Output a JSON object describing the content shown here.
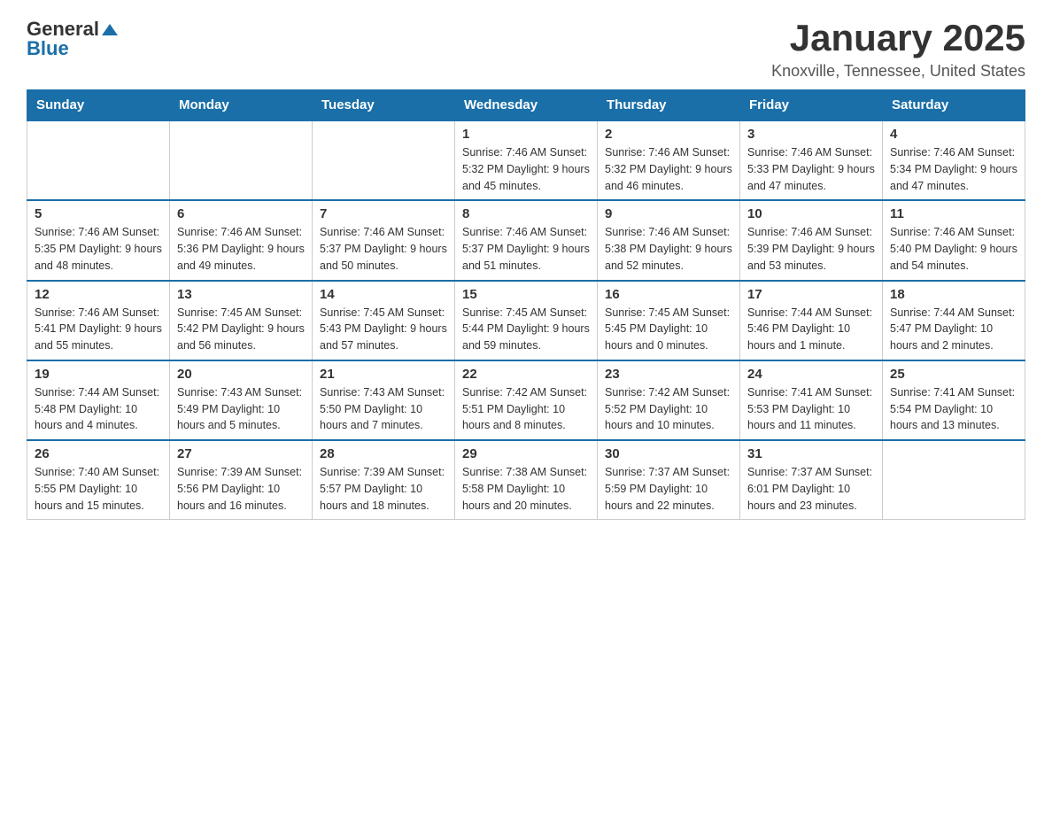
{
  "logo": {
    "general": "General",
    "blue": "Blue"
  },
  "title": "January 2025",
  "subtitle": "Knoxville, Tennessee, United States",
  "weekdays": [
    "Sunday",
    "Monday",
    "Tuesday",
    "Wednesday",
    "Thursday",
    "Friday",
    "Saturday"
  ],
  "weeks": [
    [
      {
        "day": "",
        "info": ""
      },
      {
        "day": "",
        "info": ""
      },
      {
        "day": "",
        "info": ""
      },
      {
        "day": "1",
        "info": "Sunrise: 7:46 AM\nSunset: 5:32 PM\nDaylight: 9 hours and 45 minutes."
      },
      {
        "day": "2",
        "info": "Sunrise: 7:46 AM\nSunset: 5:32 PM\nDaylight: 9 hours and 46 minutes."
      },
      {
        "day": "3",
        "info": "Sunrise: 7:46 AM\nSunset: 5:33 PM\nDaylight: 9 hours and 47 minutes."
      },
      {
        "day": "4",
        "info": "Sunrise: 7:46 AM\nSunset: 5:34 PM\nDaylight: 9 hours and 47 minutes."
      }
    ],
    [
      {
        "day": "5",
        "info": "Sunrise: 7:46 AM\nSunset: 5:35 PM\nDaylight: 9 hours and 48 minutes."
      },
      {
        "day": "6",
        "info": "Sunrise: 7:46 AM\nSunset: 5:36 PM\nDaylight: 9 hours and 49 minutes."
      },
      {
        "day": "7",
        "info": "Sunrise: 7:46 AM\nSunset: 5:37 PM\nDaylight: 9 hours and 50 minutes."
      },
      {
        "day": "8",
        "info": "Sunrise: 7:46 AM\nSunset: 5:37 PM\nDaylight: 9 hours and 51 minutes."
      },
      {
        "day": "9",
        "info": "Sunrise: 7:46 AM\nSunset: 5:38 PM\nDaylight: 9 hours and 52 minutes."
      },
      {
        "day": "10",
        "info": "Sunrise: 7:46 AM\nSunset: 5:39 PM\nDaylight: 9 hours and 53 minutes."
      },
      {
        "day": "11",
        "info": "Sunrise: 7:46 AM\nSunset: 5:40 PM\nDaylight: 9 hours and 54 minutes."
      }
    ],
    [
      {
        "day": "12",
        "info": "Sunrise: 7:46 AM\nSunset: 5:41 PM\nDaylight: 9 hours and 55 minutes."
      },
      {
        "day": "13",
        "info": "Sunrise: 7:45 AM\nSunset: 5:42 PM\nDaylight: 9 hours and 56 minutes."
      },
      {
        "day": "14",
        "info": "Sunrise: 7:45 AM\nSunset: 5:43 PM\nDaylight: 9 hours and 57 minutes."
      },
      {
        "day": "15",
        "info": "Sunrise: 7:45 AM\nSunset: 5:44 PM\nDaylight: 9 hours and 59 minutes."
      },
      {
        "day": "16",
        "info": "Sunrise: 7:45 AM\nSunset: 5:45 PM\nDaylight: 10 hours and 0 minutes."
      },
      {
        "day": "17",
        "info": "Sunrise: 7:44 AM\nSunset: 5:46 PM\nDaylight: 10 hours and 1 minute."
      },
      {
        "day": "18",
        "info": "Sunrise: 7:44 AM\nSunset: 5:47 PM\nDaylight: 10 hours and 2 minutes."
      }
    ],
    [
      {
        "day": "19",
        "info": "Sunrise: 7:44 AM\nSunset: 5:48 PM\nDaylight: 10 hours and 4 minutes."
      },
      {
        "day": "20",
        "info": "Sunrise: 7:43 AM\nSunset: 5:49 PM\nDaylight: 10 hours and 5 minutes."
      },
      {
        "day": "21",
        "info": "Sunrise: 7:43 AM\nSunset: 5:50 PM\nDaylight: 10 hours and 7 minutes."
      },
      {
        "day": "22",
        "info": "Sunrise: 7:42 AM\nSunset: 5:51 PM\nDaylight: 10 hours and 8 minutes."
      },
      {
        "day": "23",
        "info": "Sunrise: 7:42 AM\nSunset: 5:52 PM\nDaylight: 10 hours and 10 minutes."
      },
      {
        "day": "24",
        "info": "Sunrise: 7:41 AM\nSunset: 5:53 PM\nDaylight: 10 hours and 11 minutes."
      },
      {
        "day": "25",
        "info": "Sunrise: 7:41 AM\nSunset: 5:54 PM\nDaylight: 10 hours and 13 minutes."
      }
    ],
    [
      {
        "day": "26",
        "info": "Sunrise: 7:40 AM\nSunset: 5:55 PM\nDaylight: 10 hours and 15 minutes."
      },
      {
        "day": "27",
        "info": "Sunrise: 7:39 AM\nSunset: 5:56 PM\nDaylight: 10 hours and 16 minutes."
      },
      {
        "day": "28",
        "info": "Sunrise: 7:39 AM\nSunset: 5:57 PM\nDaylight: 10 hours and 18 minutes."
      },
      {
        "day": "29",
        "info": "Sunrise: 7:38 AM\nSunset: 5:58 PM\nDaylight: 10 hours and 20 minutes."
      },
      {
        "day": "30",
        "info": "Sunrise: 7:37 AM\nSunset: 5:59 PM\nDaylight: 10 hours and 22 minutes."
      },
      {
        "day": "31",
        "info": "Sunrise: 7:37 AM\nSunset: 6:01 PM\nDaylight: 10 hours and 23 minutes."
      },
      {
        "day": "",
        "info": ""
      }
    ]
  ]
}
